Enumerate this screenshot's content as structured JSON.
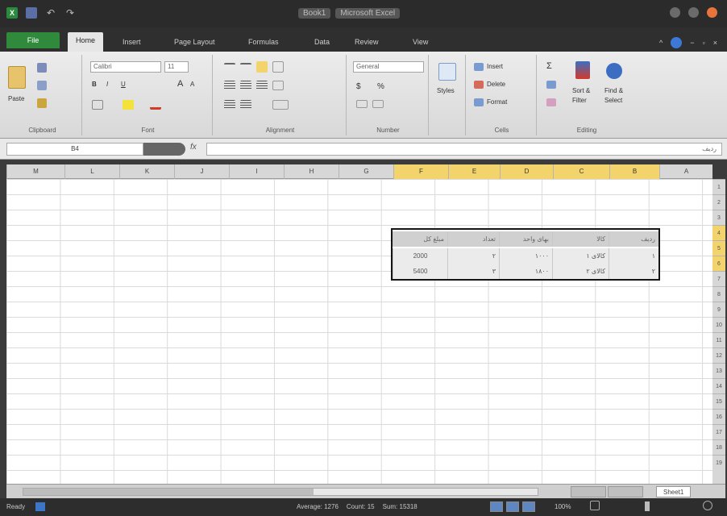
{
  "title": {
    "file_name": "Book1",
    "app_name": "Microsoft Excel"
  },
  "tabs": [
    "File",
    "Home",
    "Insert",
    "Page Layout",
    "Formulas",
    "Data",
    "Review",
    "View"
  ],
  "ribbon": {
    "clipboard": {
      "paste": "Paste",
      "label": "Clipboard"
    },
    "font": {
      "name": "Calibri",
      "size": "11",
      "label": "Font",
      "bold": "B",
      "italic": "I",
      "underline": "U",
      "grow": "A",
      "shrink": "A"
    },
    "alignment": {
      "label": "Alignment"
    },
    "number": {
      "format": "General",
      "currency": "$",
      "percent": "%",
      "label": "Number"
    },
    "styles": {
      "label": "Styles"
    },
    "cells": {
      "insert": "Insert",
      "delete": "Delete",
      "format": "Format",
      "label": "Cells"
    },
    "editing": {
      "sigma": "Σ",
      "sort": "Sort &",
      "filter": "Filter",
      "find": "Find &",
      "select": "Select",
      "label": "Editing"
    }
  },
  "formula_bar": {
    "name_box": "B4",
    "fx": "fx",
    "content": "ردیف"
  },
  "columns": [
    "M",
    "L",
    "K",
    "J",
    "I",
    "H",
    "G",
    "F",
    "E",
    "D",
    "C",
    "B",
    "A"
  ],
  "selected_columns": [
    "F",
    "E",
    "D",
    "C",
    "B"
  ],
  "rows": [
    "1",
    "2",
    "3",
    "4",
    "5",
    "6",
    "7",
    "8",
    "9",
    "10",
    "11",
    "12",
    "13",
    "14",
    "15",
    "16",
    "17",
    "18",
    "19"
  ],
  "selected_rows": [
    "4",
    "5",
    "6"
  ],
  "table": {
    "headers": {
      "b": "ردیف",
      "c": "کالا",
      "d": "بهای واحد",
      "e": "تعداد",
      "f": "مبلغ کل"
    },
    "rows": [
      {
        "b": "۱",
        "c": "کالای ۱",
        "d": "۱۰۰۰",
        "e": "۲",
        "f": "2000"
      },
      {
        "b": "۲",
        "c": "کالای ۲",
        "d": "۱۸۰۰",
        "e": "۳",
        "f": "5400"
      }
    ]
  },
  "sheet_tab": "Sheet1",
  "status": {
    "ready": "Ready",
    "average": "Average: 1276",
    "count": "Count: 15",
    "sum": "Sum: 15318",
    "zoom": "100%"
  },
  "colors": {
    "accent": "#2f8a3c",
    "selection": "#f3d36b"
  }
}
